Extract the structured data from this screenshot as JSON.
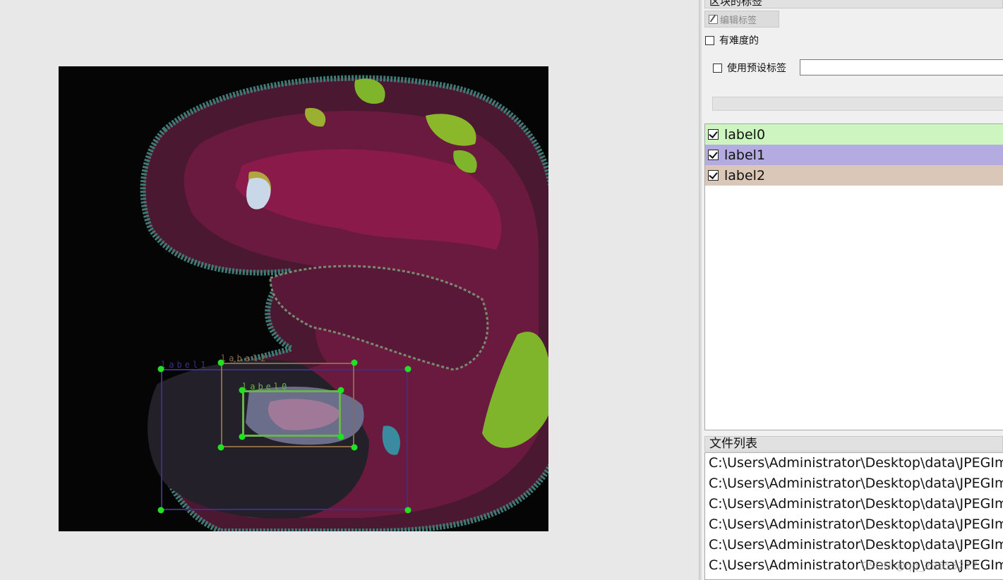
{
  "canvas": {
    "boxes": [
      {
        "label": "label1",
        "color": "#3b2f86"
      },
      {
        "label": "label2",
        "color": "#8a6a4a"
      },
      {
        "label": "label0",
        "color": "#6ab44f"
      }
    ]
  },
  "panel": {
    "region_labels_title": "区块的标签",
    "edit_label_button": "编辑标签",
    "difficult_checkbox": "有难度的",
    "use_preset_checkbox": "使用预设标签",
    "preset_input_value": "",
    "labels": [
      {
        "name": "label0",
        "checked": true,
        "color": "#cdf5bf"
      },
      {
        "name": "label1",
        "checked": true,
        "color": "#b4ace0"
      },
      {
        "name": "label2",
        "checked": true,
        "color": "#dbc7b8"
      }
    ],
    "file_list_title": "文件列表",
    "files": [
      "C:\\Users\\Administrator\\Desktop\\data\\JPEGIm",
      "C:\\Users\\Administrator\\Desktop\\data\\JPEGIm",
      "C:\\Users\\Administrator\\Desktop\\data\\JPEGIm",
      "C:\\Users\\Administrator\\Desktop\\data\\JPEGIm",
      "C:\\Users\\Administrator\\Desktop\\data\\JPEGIm",
      "C:\\Users\\Administrator\\Desktop\\data\\JPEGIm"
    ]
  },
  "watermark": "CSDN @qq_29653227"
}
